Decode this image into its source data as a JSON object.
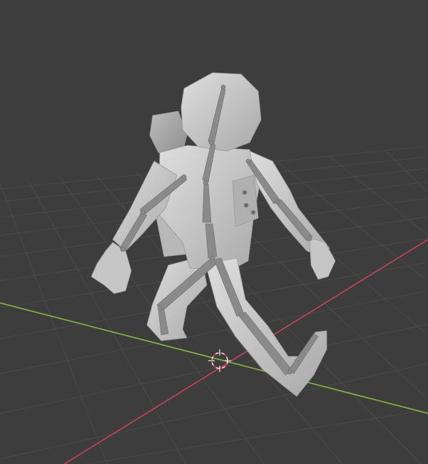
{
  "viewport": {
    "background": "#3d3d3d",
    "grid_color": "#4a4a4a",
    "x_axis_color": "#c8435a",
    "y_axis_color": "#86b83a",
    "mesh_color": "#c9c9c9",
    "mesh_shadow": "#8f8f8f",
    "bone_color": "#8a8a8a",
    "cursor_color": "#e8e8e8",
    "cursor_accent": "#d83838"
  },
  "scene": {
    "object": "astronaut-character",
    "armature": "character-armature",
    "cursor": "3d-cursor-icon"
  }
}
